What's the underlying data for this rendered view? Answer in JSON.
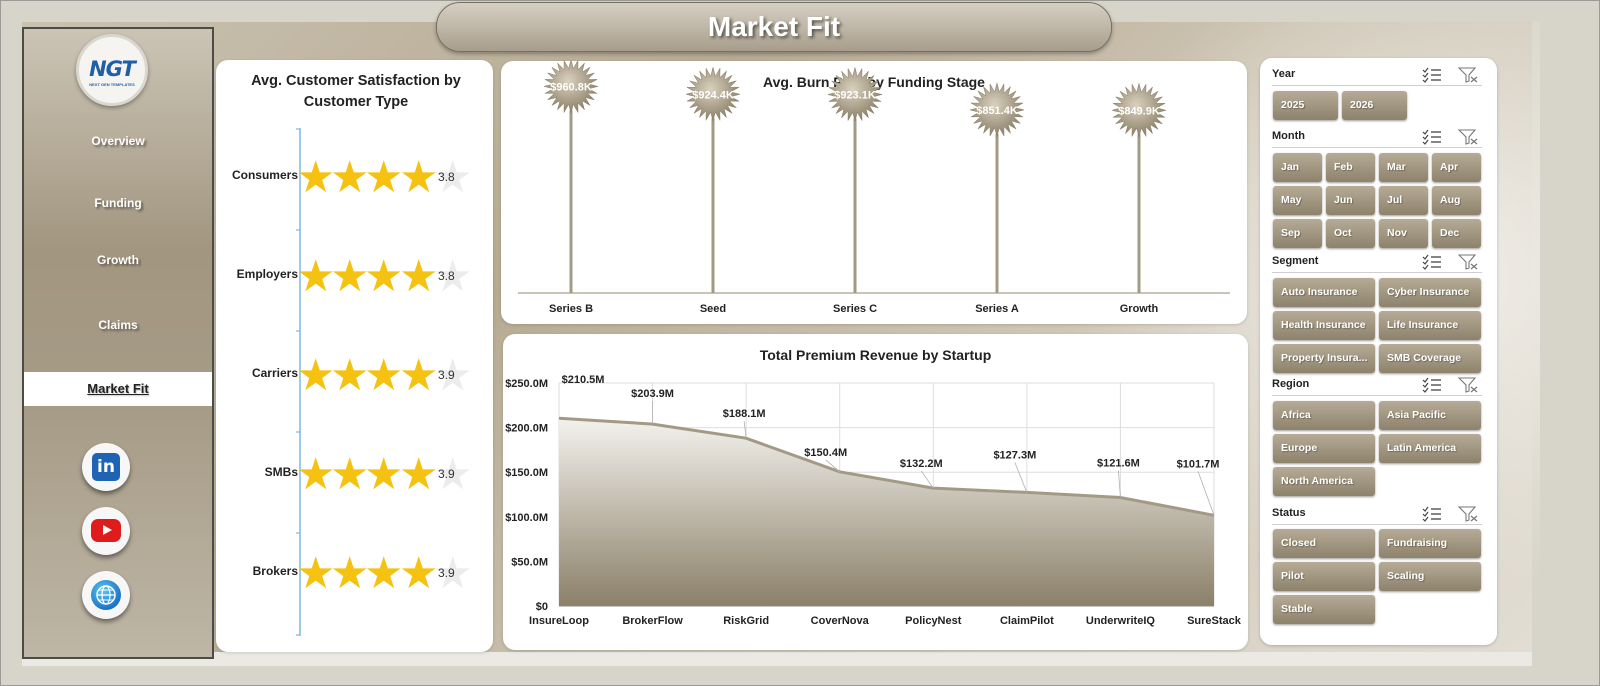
{
  "title": "Market Fit",
  "logo": {
    "text": "NGT",
    "tagline": "NEXT GEN TEMPLATES"
  },
  "nav": {
    "items": [
      "Overview",
      "Funding",
      "Growth",
      "Claims",
      "Market Fit"
    ],
    "active": "Market Fit"
  },
  "social": [
    "linkedin-icon",
    "youtube-icon",
    "globe-icon"
  ],
  "colors": {
    "accent": "#a69b86",
    "star": "#f5c211",
    "line": "#a39a85",
    "chip": "#9c917c"
  },
  "satisfaction": {
    "title": "Avg. Customer Satisfaction by Customer Type",
    "rows": [
      {
        "label": "Consumers",
        "value": "3.8",
        "stars": 4
      },
      {
        "label": "Employers",
        "value": "3.8",
        "stars": 4
      },
      {
        "label": "Carriers",
        "value": "3.9",
        "stars": 4
      },
      {
        "label": "SMBs",
        "value": "3.9",
        "stars": 4
      },
      {
        "label": "Brokers",
        "value": "3.9",
        "stars": 4
      }
    ]
  },
  "chart_data": [
    {
      "type": "bar",
      "title": "Avg. Burn Rate by Funding Stage",
      "categories": [
        "Series B",
        "Seed",
        "Series C",
        "Series A",
        "Growth"
      ],
      "values": [
        960.8,
        924.4,
        923.1,
        851.4,
        849.9
      ],
      "data_labels": [
        "$960.8K",
        "$924.4K",
        "$923.1K",
        "$851.4K",
        "$849.9K"
      ],
      "units": "K"
    },
    {
      "type": "area",
      "title": "Total Premium Revenue by Startup",
      "categories": [
        "InsureLoop",
        "BrokerFlow",
        "RiskGrid",
        "CoverNova",
        "PolicyNest",
        "ClaimPilot",
        "UnderwriteIQ",
        "SureStack"
      ],
      "values": [
        210.5,
        203.9,
        188.1,
        150.4,
        132.2,
        127.3,
        121.6,
        101.7
      ],
      "data_labels": [
        "$210.5M",
        "$203.9M",
        "$188.1M",
        "$150.4M",
        "$132.2M",
        "$127.3M",
        "$121.6M",
        "$101.7M"
      ],
      "yticks": [
        "$0",
        "$50.0M",
        "$100.0M",
        "$150.0M",
        "$200.0M",
        "$250.0M"
      ],
      "ylim": [
        0,
        250
      ],
      "grid": true
    }
  ],
  "slicers": [
    {
      "label": "Year",
      "options": [
        "2025",
        "2026"
      ]
    },
    {
      "label": "Month",
      "options": [
        "Jan",
        "Feb",
        "Mar",
        "Apr",
        "May",
        "Jun",
        "Jul",
        "Aug",
        "Sep",
        "Oct",
        "Nov",
        "Dec"
      ]
    },
    {
      "label": "Segment",
      "options": [
        "Auto Insurance",
        "Cyber Insurance",
        "Health Insurance",
        "Life Insurance",
        "Property Insura...",
        "SMB Coverage"
      ]
    },
    {
      "label": "Region",
      "options": [
        "Africa",
        "Asia Pacific",
        "Europe",
        "Latin America",
        "North America"
      ]
    },
    {
      "label": "Status",
      "options": [
        "Closed",
        "Fundraising",
        "Pilot",
        "Scaling",
        "Stable"
      ]
    }
  ]
}
